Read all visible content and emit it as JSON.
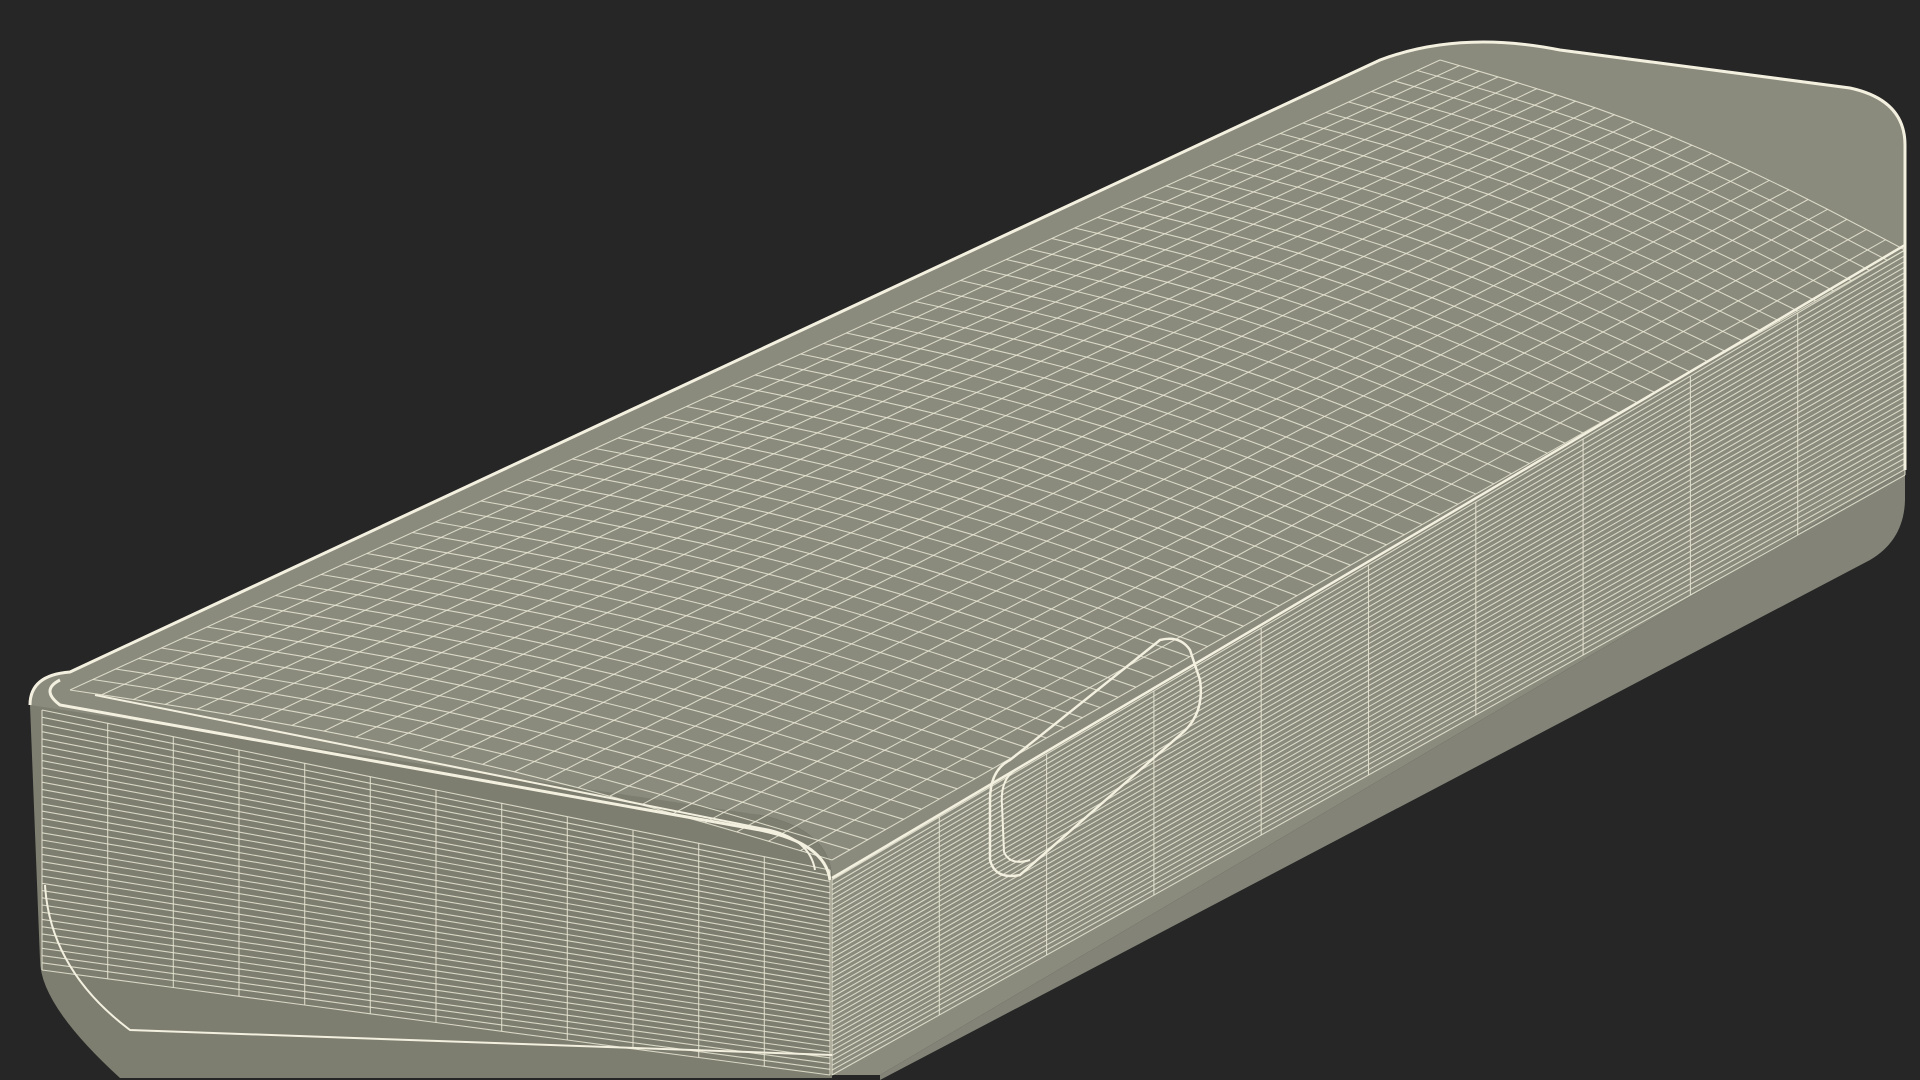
{
  "scene": {
    "subject": "wireframe-3d-model",
    "colors": {
      "background": "#262626",
      "surface_top": "#8a8b7d",
      "surface_front": "#7d7e70",
      "surface_side": "#838477",
      "wire": "#e9e6d4",
      "edge_highlight": "#f3f0df",
      "shadow": "#5c5d52"
    },
    "mesh": {
      "top_rows": 24,
      "top_cols": 60,
      "front_rows": 12,
      "front_cols": 36,
      "side_rows": 10,
      "side_cols": 40
    }
  }
}
